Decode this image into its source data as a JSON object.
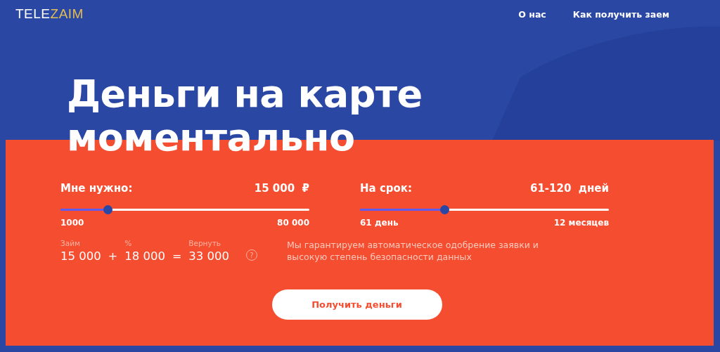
{
  "logo": [
    {
      "text": "TELE",
      "color": "#ffffff"
    },
    {
      "text": "ZAIM",
      "color": "#e3bd55"
    }
  ],
  "nav": [
    {
      "label": "О нас"
    },
    {
      "label": "Как получить заем"
    }
  ],
  "headline": "Деньги на карте моментально",
  "sliders": [
    {
      "label": "Мне нужно:",
      "value": "15 000",
      "unit": "₽",
      "level": 0.19,
      "min": "1000",
      "max": "80 000"
    },
    {
      "label": "На срок:",
      "value": "61-120",
      "unit": "дней",
      "level": 0.34,
      "min": "61 день",
      "max": "12 месяцев"
    }
  ],
  "calc": [
    {
      "caption": "Займ",
      "value": "15 000"
    },
    {
      "operator": "+"
    },
    {
      "caption": "%",
      "value": "18 000"
    },
    {
      "operator": "="
    },
    {
      "caption": "Вернуть",
      "value": "33 000"
    }
  ],
  "help_icon": "?",
  "note": "Мы гарантируем автоматическое одобрение заявки и высокую степень безопасности данных",
  "button": "Получить деньги"
}
